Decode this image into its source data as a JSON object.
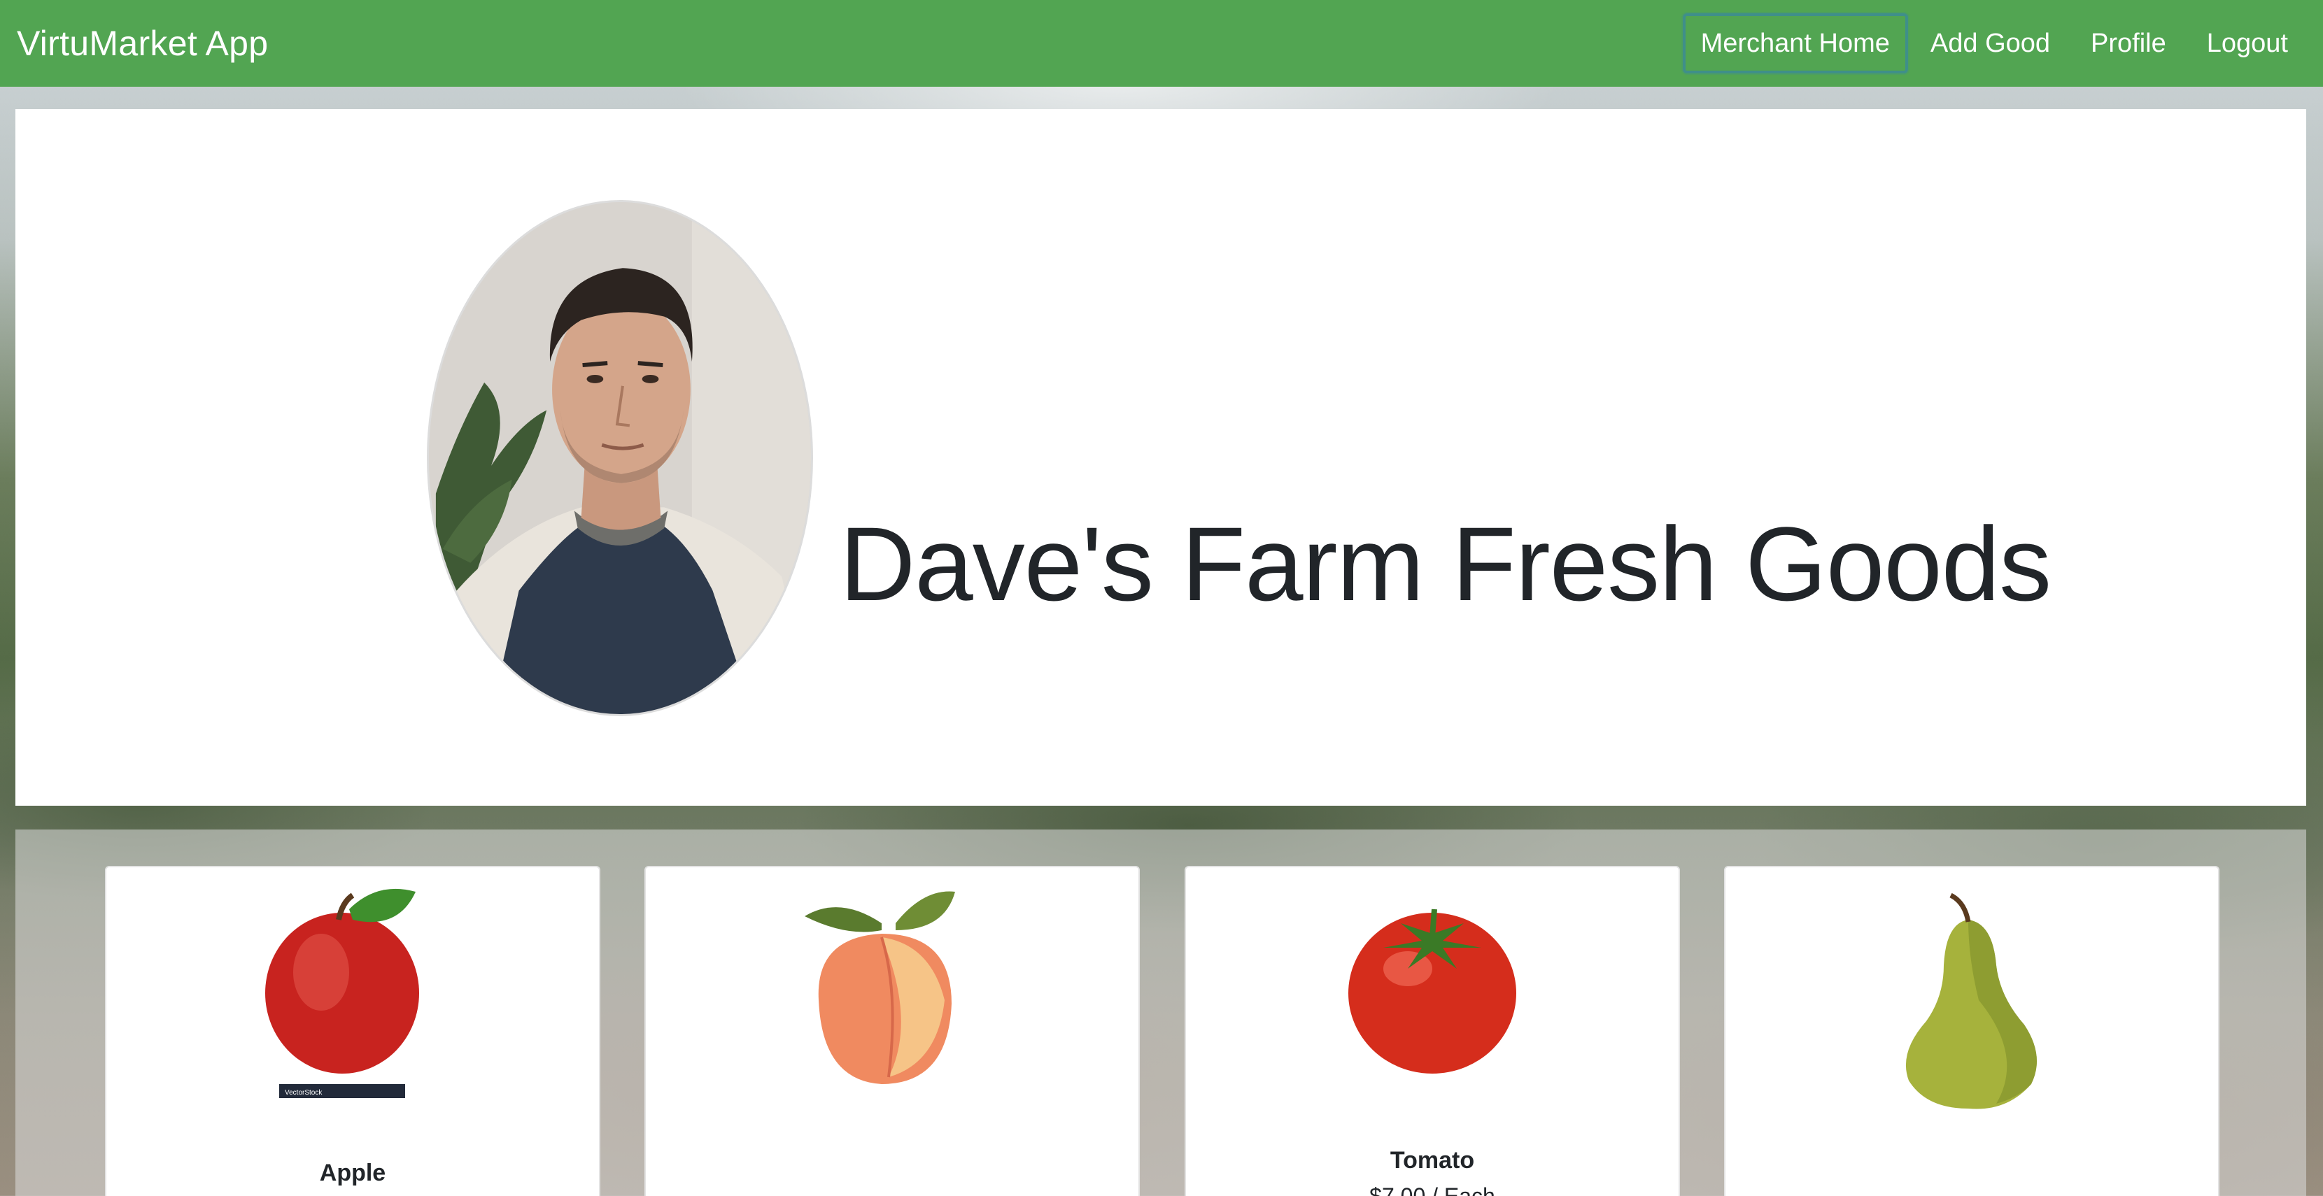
{
  "navbar": {
    "brand": "VirtuMarket App",
    "links": [
      {
        "label": "Merchant Home",
        "active": true
      },
      {
        "label": "Add Good",
        "active": false
      },
      {
        "label": "Profile",
        "active": false
      },
      {
        "label": "Logout",
        "active": false
      }
    ],
    "color": "#52a552"
  },
  "hero": {
    "shop_name": "Dave's Farm Fresh Goods"
  },
  "goods": [
    {
      "name": "Apple",
      "image_icon": "apple-icon",
      "watermark": "VectorStock"
    },
    {
      "name": "",
      "image_icon": "peach-icon"
    },
    {
      "name": "Tomato",
      "price": "$7.00 / Each",
      "image_icon": "tomato-icon"
    },
    {
      "name": "",
      "image_icon": "pear-icon"
    }
  ]
}
